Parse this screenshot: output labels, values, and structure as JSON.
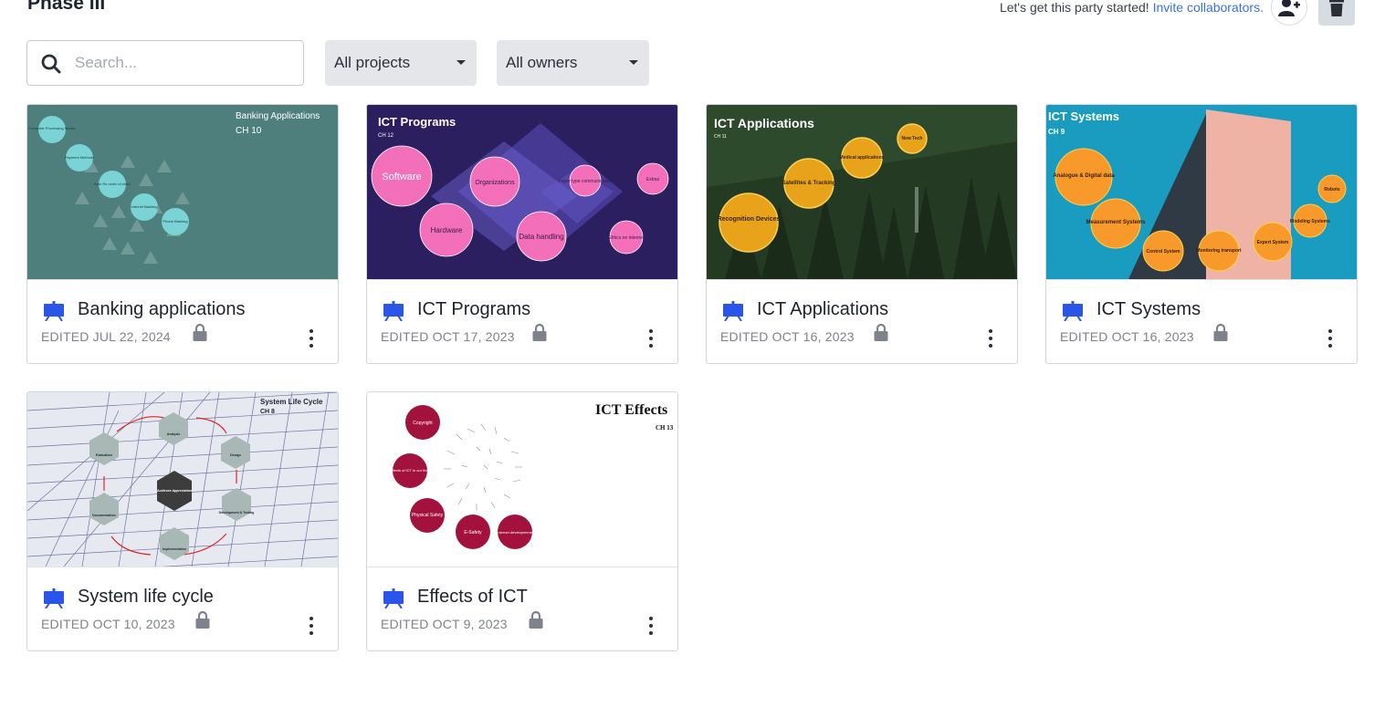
{
  "header": {
    "title": "Phase III",
    "party_text": "Let's get this party started!",
    "invite_link": "Invite collaborators."
  },
  "filters": {
    "search_placeholder": "Search...",
    "projects_selected": "All projects",
    "owners_selected": "All owners"
  },
  "cards": [
    {
      "title": "Banking applications",
      "date": "EDITED JUL 22, 2024",
      "thumb": {
        "heading": "Banking Applications",
        "sub": "CH 10",
        "bubbles": [
          "Computer Processing Modes",
          "Payment Methods",
          "Auto Re-order of stock",
          "Internet Banking",
          "Phone Banking"
        ]
      }
    },
    {
      "title": "ICT Programs",
      "date": "EDITED OCT 17, 2023",
      "thumb": {
        "heading": "ICT Programs",
        "sub": "CH 12",
        "bubbles": [
          "Software",
          "Organizations",
          "Paper type communication",
          "Extras",
          "Hardware",
          "Data handling",
          "Ethics on internet"
        ]
      }
    },
    {
      "title": "ICT Applications",
      "date": "EDITED OCT 16, 2023",
      "thumb": {
        "heading": "ICT Applications",
        "sub": "CH 11",
        "bubbles": [
          "New Tech",
          "Medical applications",
          "Satellites & Tracking",
          "Recognition Devices"
        ]
      }
    },
    {
      "title": "ICT Systems",
      "date": "EDITED OCT 16, 2023",
      "thumb": {
        "heading": "ICT Systems",
        "sub": "CH 9",
        "bubbles": [
          "Analogue & Digital data",
          "Measurement Systems",
          "Robots",
          "Modeling Systems",
          "Expert System",
          "Monitoring transport",
          "Control System"
        ]
      }
    },
    {
      "title": "System life cycle",
      "date": "EDITED OCT 10, 2023",
      "thumb": {
        "heading": "System Life Cycle",
        "sub": "CH 8",
        "bubbles": [
          "Analysis",
          "Design",
          "Development & Testing",
          "Implementation",
          "Documentation",
          "Evaluation",
          "Audience Appreciation"
        ]
      }
    },
    {
      "title": "Effects of ICT",
      "date": "EDITED OCT 9, 2023",
      "thumb": {
        "heading": "ICT Effects",
        "sub": "CH 13",
        "bubbles": [
          "Copyright",
          "Effects of ICT in our lives",
          "Physical Safety",
          "E-Safety",
          "Internet developments"
        ]
      }
    }
  ],
  "colors": {
    "accent_link": "#3d6fe0",
    "presentation_icon": "#2a55e8",
    "card_border": "#d3d6dc"
  },
  "icons": {
    "search": "search-icon",
    "add_user": "add-user-icon",
    "trash": "trash-icon",
    "presentation": "presentation-icon",
    "lock": "lock-icon",
    "more": "more-vertical-icon"
  }
}
